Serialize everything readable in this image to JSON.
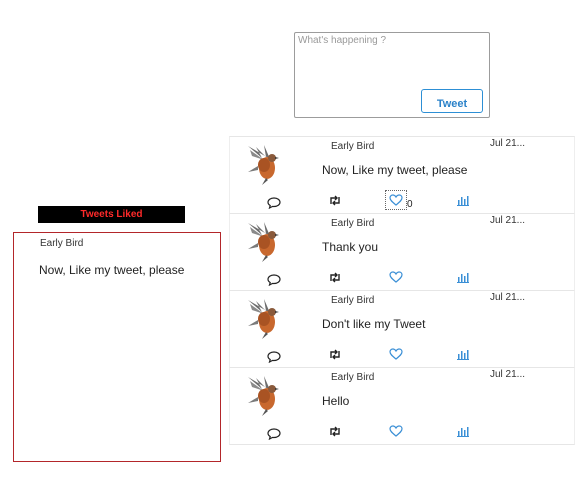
{
  "compose": {
    "placeholder": "What's happening ?",
    "button_label": "Tweet"
  },
  "liked": {
    "header": "Tweets Liked",
    "items": [
      {
        "author": "Early Bird",
        "text": "Now, Like my tweet, please"
      }
    ]
  },
  "feed": [
    {
      "author": "Early Bird",
      "date": "Jul 21...",
      "text": "Now, Like my tweet, please",
      "like_count": "0",
      "like_focused": true
    },
    {
      "author": "Early Bird",
      "date": "Jul 21...",
      "text": "Thank you"
    },
    {
      "author": "Early Bird",
      "date": "Jul 21...",
      "text": "Don't like my Tweet"
    },
    {
      "author": "Early Bird",
      "date": "Jul 21...",
      "text": "Hello"
    }
  ],
  "colors": {
    "accent": "#2b82c9",
    "liked_header_bg": "#000000",
    "liked_header_text": "#ff2a2a",
    "liked_border": "#b3262a"
  }
}
